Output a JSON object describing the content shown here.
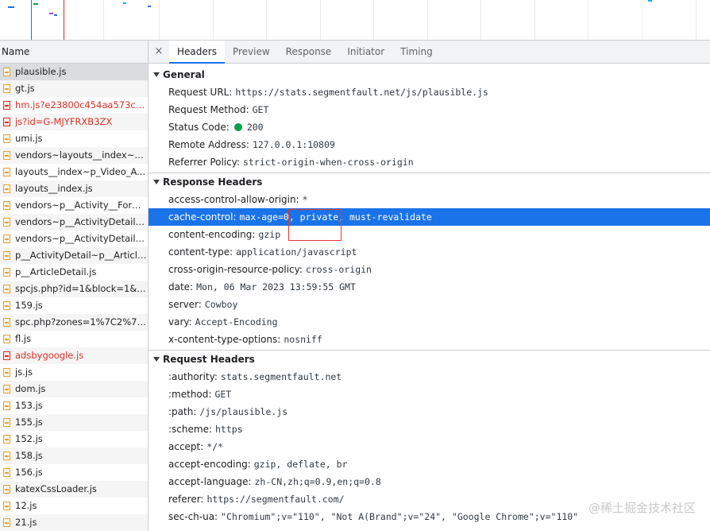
{
  "request_list": {
    "column_header": "Name",
    "rows": [
      {
        "name": "plausible.js",
        "error": false,
        "selected": true
      },
      {
        "name": "gt.js",
        "error": false
      },
      {
        "name": "hm.js?e23800c454aa573c0c...",
        "error": true
      },
      {
        "name": "js?id=G-MJYFRXB3ZX",
        "error": true
      },
      {
        "name": "umi.js",
        "error": false
      },
      {
        "name": "vendors~layouts__index~p_...",
        "error": false
      },
      {
        "name": "layouts__index~p_Video_A...",
        "error": false
      },
      {
        "name": "layouts__index.js",
        "error": false
      },
      {
        "name": "vendors~p__Activity__Form...",
        "error": false
      },
      {
        "name": "vendors~p__ActivityDetail~...",
        "error": false
      },
      {
        "name": "vendors~p__ActivityDetail~...",
        "error": false
      },
      {
        "name": "p__ActivityDetail~p__Article...",
        "error": false
      },
      {
        "name": "p__ArticleDetail.js",
        "error": false
      },
      {
        "name": "spcjs.php?id=1&block=1&r...",
        "error": false
      },
      {
        "name": "159.js",
        "error": false
      },
      {
        "name": "spc.php?zones=1%7C2%7C...",
        "error": false
      },
      {
        "name": "fl.js",
        "error": false
      },
      {
        "name": "adsbygoogle.js",
        "error": true
      },
      {
        "name": "js.js",
        "error": false
      },
      {
        "name": "dom.js",
        "error": false
      },
      {
        "name": "153.js",
        "error": false
      },
      {
        "name": "155.js",
        "error": false
      },
      {
        "name": "152.js",
        "error": false
      },
      {
        "name": "158.js",
        "error": false
      },
      {
        "name": "156.js",
        "error": false
      },
      {
        "name": "katexCssLoader.js",
        "error": false
      },
      {
        "name": "12.js",
        "error": false
      },
      {
        "name": "21.js",
        "error": false
      }
    ]
  },
  "tabs": {
    "close_glyph": "×",
    "items": [
      "Headers",
      "Preview",
      "Response",
      "Initiator",
      "Timing"
    ],
    "active": "Headers"
  },
  "general": {
    "title": "General",
    "items": [
      {
        "key": "Request URL:",
        "value": "https://stats.segmentfault.net/js/plausible.js"
      },
      {
        "key": "Request Method:",
        "value": "GET"
      },
      {
        "key": "Status Code:",
        "value": "200",
        "status_dot": true
      },
      {
        "key": "Remote Address:",
        "value": "127.0.0.1:10809"
      },
      {
        "key": "Referrer Policy:",
        "value": "strict-origin-when-cross-origin"
      }
    ]
  },
  "response_headers": {
    "title": "Response Headers",
    "items": [
      {
        "key": "access-control-allow-origin:",
        "value": "*"
      },
      {
        "key": "cache-control:",
        "value": "max-age=0, private, must-revalidate",
        "highlight": true
      },
      {
        "key": "content-encoding:",
        "value": "gzip"
      },
      {
        "key": "content-type:",
        "value": "application/javascript"
      },
      {
        "key": "cross-origin-resource-policy:",
        "value": "cross-origin"
      },
      {
        "key": "date:",
        "value": "Mon, 06 Mar 2023 13:59:55 GMT"
      },
      {
        "key": "server:",
        "value": "Cowboy"
      },
      {
        "key": "vary:",
        "value": "Accept-Encoding"
      },
      {
        "key": "x-content-type-options:",
        "value": "nosniff"
      }
    ]
  },
  "request_headers": {
    "title": "Request Headers",
    "items": [
      {
        "key": ":authority:",
        "value": "stats.segmentfault.net"
      },
      {
        "key": ":method:",
        "value": "GET"
      },
      {
        "key": ":path:",
        "value": "/js/plausible.js"
      },
      {
        "key": ":scheme:",
        "value": "https"
      },
      {
        "key": "accept:",
        "value": "*/*"
      },
      {
        "key": "accept-encoding:",
        "value": "gzip, deflate, br"
      },
      {
        "key": "accept-language:",
        "value": "zh-CN,zh;q=0.9,en;q=0.8"
      },
      {
        "key": "referer:",
        "value": "https://segmentfault.com/"
      },
      {
        "key": "sec-ch-ua:",
        "value": "\"Chromium\";v=\"110\", \"Not A(Brand\";v=\"24\", \"Google Chrome\";v=\"110\""
      }
    ]
  },
  "watermark": "@稀土掘金技术社区",
  "colors": {
    "highlight": "#1a73e8",
    "error_text": "#d93025",
    "status_ok": "#0a9d4c",
    "annotation": "#e53935"
  }
}
